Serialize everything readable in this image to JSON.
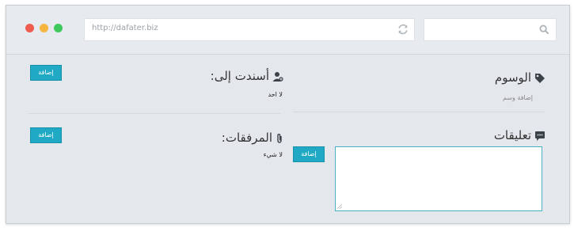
{
  "browser": {
    "url": "http://dafater.biz",
    "search_placeholder": ""
  },
  "colors": {
    "accent": "#1fa9c4",
    "dot_red": "#ee5b4f",
    "dot_yellow": "#f5b540",
    "dot_green": "#3fc95c"
  },
  "tags": {
    "title": "الوسوم",
    "add_tag_label": "إضافة وسم",
    "icon": "tag-icon"
  },
  "comments": {
    "title": "تعليقات",
    "add_button": "إضافة",
    "icon": "comment-icon",
    "textarea_value": ""
  },
  "assigned": {
    "title": "أسندت إلى:",
    "value": "لا احد",
    "add_button": "إضافة",
    "icon": "user-add-icon"
  },
  "attachments": {
    "title": "المرفقات:",
    "value": "لا شيء",
    "add_button": "إضافة",
    "icon": "paperclip-icon"
  }
}
